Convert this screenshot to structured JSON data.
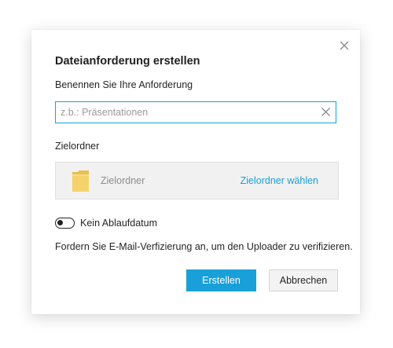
{
  "dialog": {
    "title": "Dateianforderung erstellen",
    "name_label": "Benennen Sie Ihre Anforderung",
    "name_input": {
      "value": "",
      "placeholder": "z.b.: Präsentationen"
    },
    "folder_label": "Zielordner",
    "folder_box": {
      "folder_name": "Zielordner",
      "choose_link": "Zielordner wählen"
    },
    "expiry_toggle": {
      "label": "Kein Ablaufdatum",
      "state": "off"
    },
    "verification_text": "Fordern Sie E-Mail-Verfizierung an, um den Uploader zu verifizieren.",
    "buttons": {
      "create": "Erstellen",
      "cancel": "Abbrechen"
    }
  },
  "icons": {
    "close": "close-icon",
    "clear": "clear-icon",
    "folder": "folder-icon"
  },
  "colors": {
    "accent": "#1aa0d9",
    "folder_yellow": "#f5d36b",
    "text": "#252525",
    "placeholder": "#9a9a9a"
  }
}
